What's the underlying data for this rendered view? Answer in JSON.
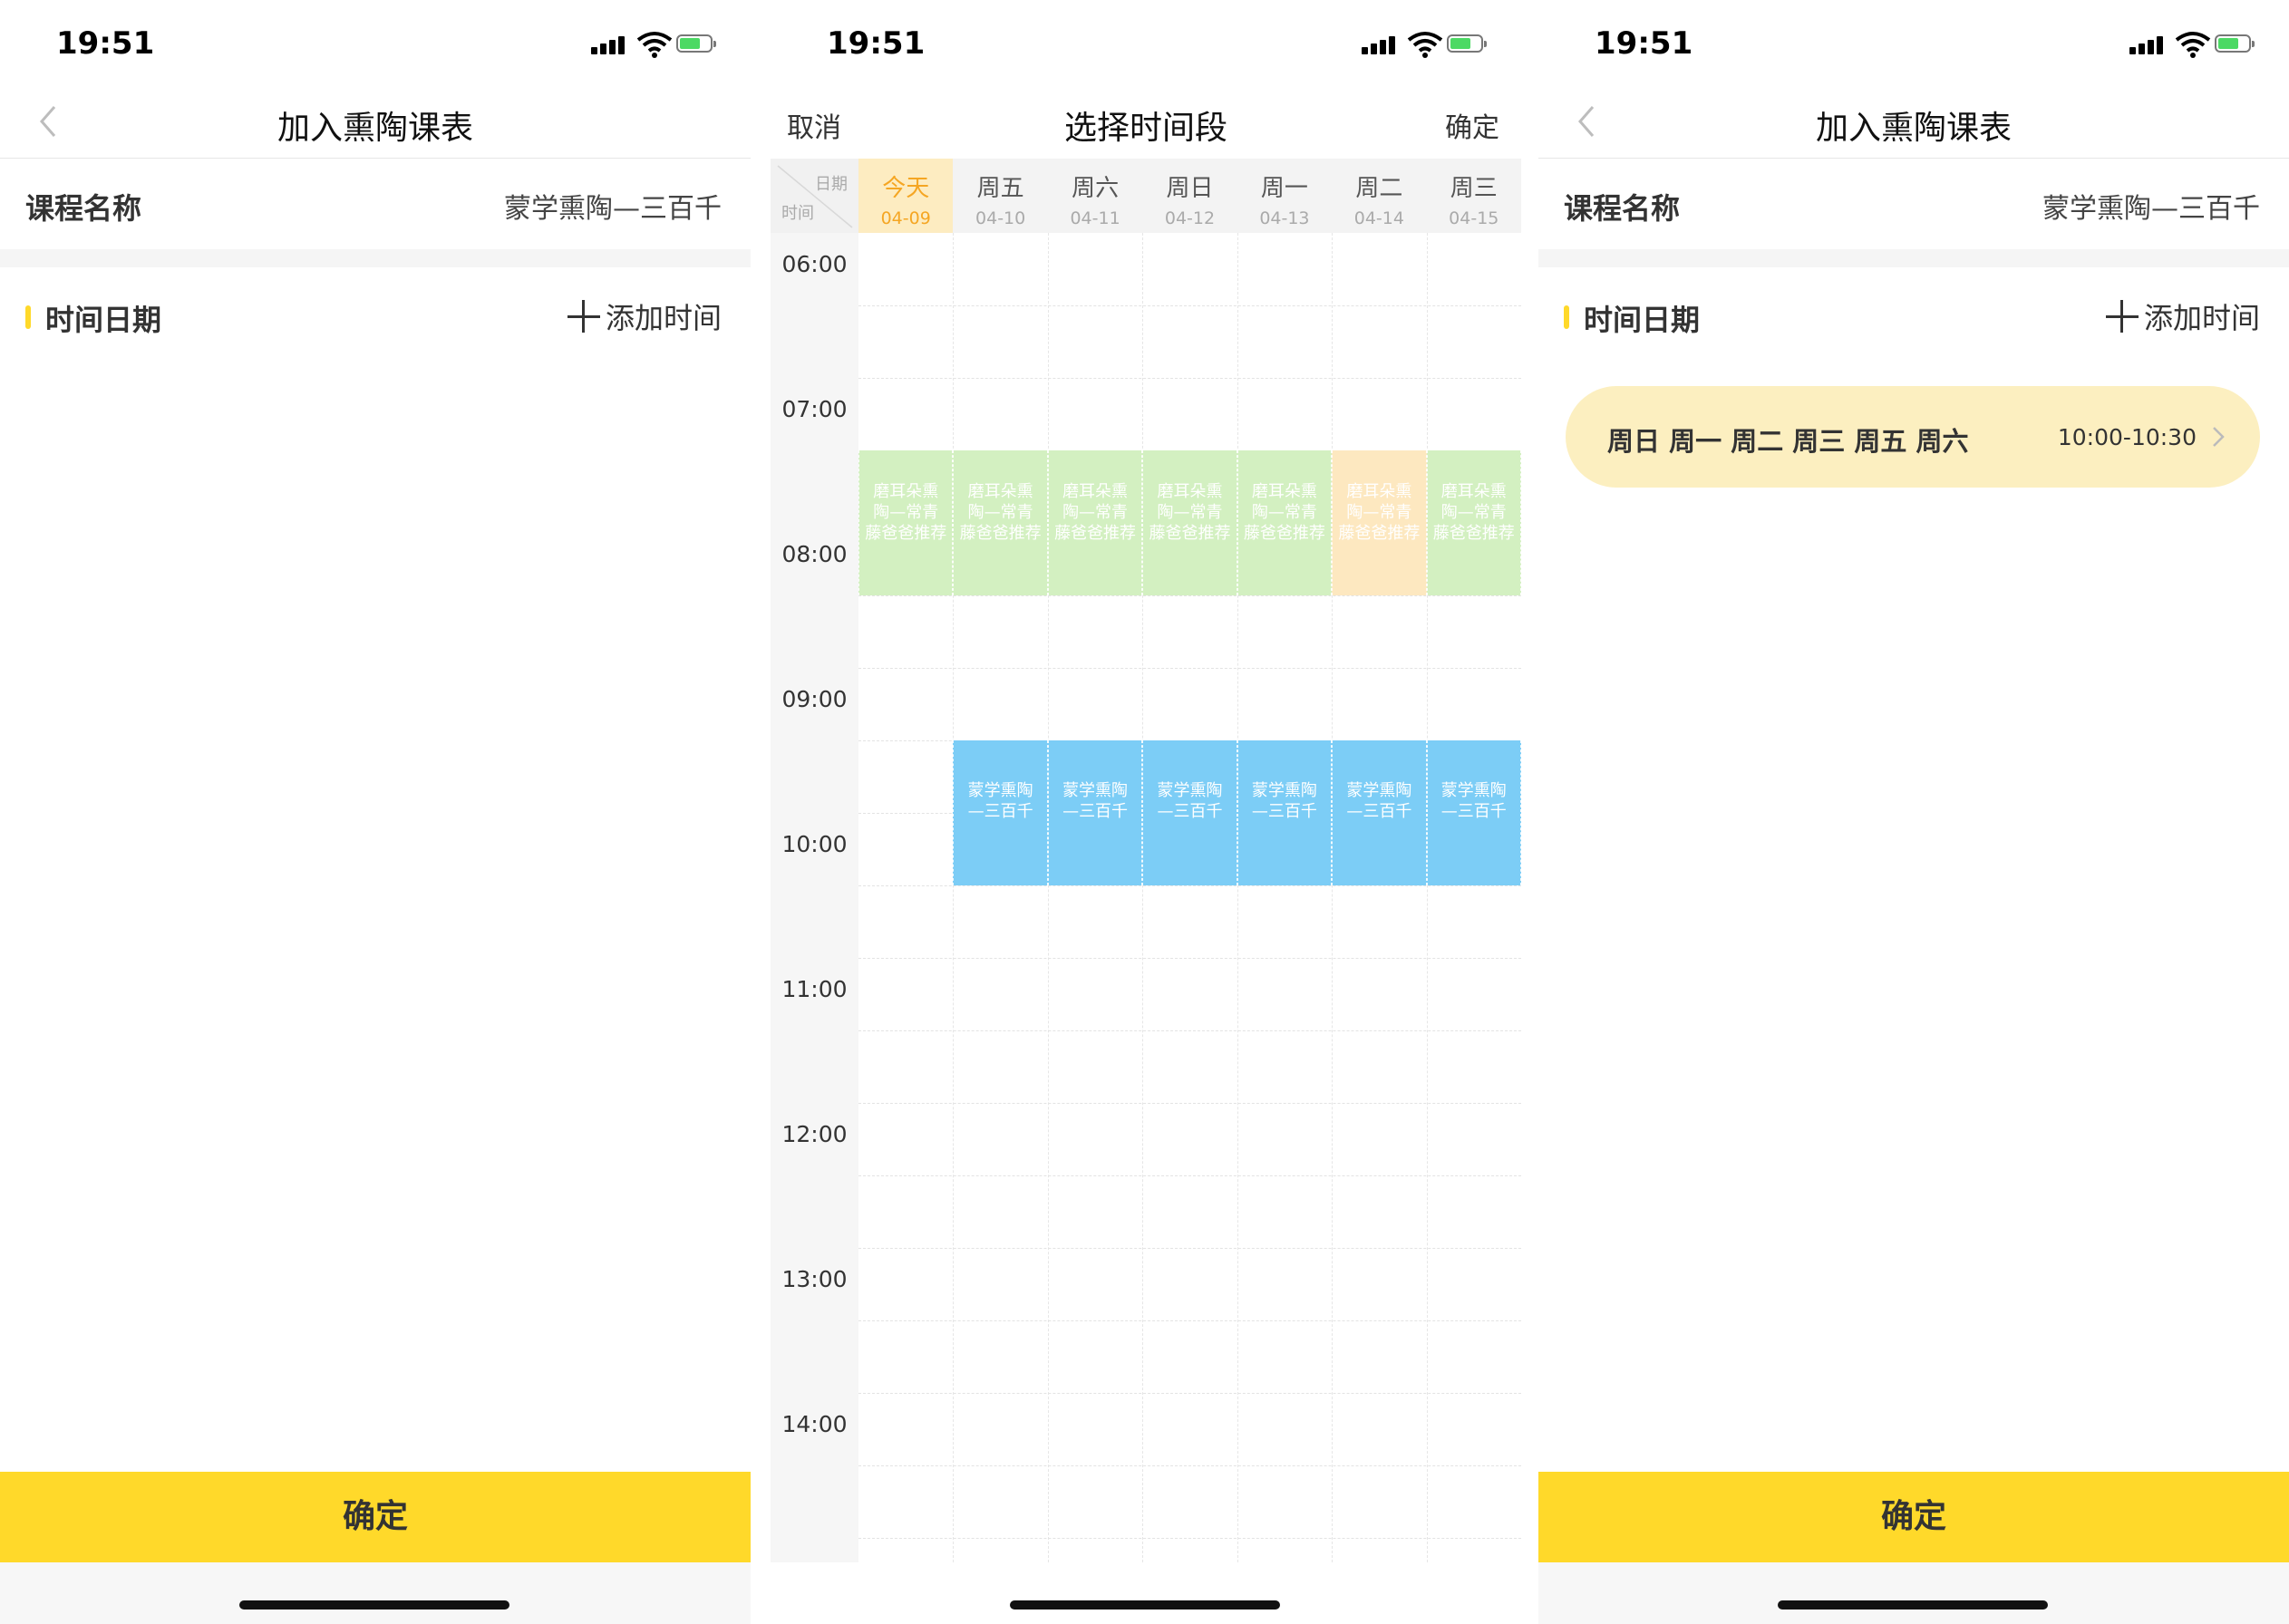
{
  "status_bar": {
    "time": "19:51"
  },
  "screen_add": {
    "title": "加入熏陶课表",
    "course_label": "课程名称",
    "course_value": "蒙学熏陶—三百千",
    "time_label": "时间日期",
    "add_time_label": "添加时间",
    "confirm_label": "确定"
  },
  "screen_select": {
    "title": "选择时间段",
    "cancel_label": "取消",
    "confirm_label": "确定",
    "corner_date": "日期",
    "corner_time": "时间",
    "days": [
      {
        "name": "今天",
        "date": "04-09",
        "today": true
      },
      {
        "name": "周五",
        "date": "04-10"
      },
      {
        "name": "周六",
        "date": "04-11"
      },
      {
        "name": "周日",
        "date": "04-12"
      },
      {
        "name": "周一",
        "date": "04-13"
      },
      {
        "name": "周二",
        "date": "04-14"
      },
      {
        "name": "周三",
        "date": "04-15"
      }
    ],
    "hours": [
      "06:00",
      "07:00",
      "08:00",
      "09:00",
      "10:00",
      "11:00",
      "12:00",
      "13:00",
      "14:00"
    ],
    "blocks": [
      {
        "day": 0,
        "start": 7.5,
        "end": 8.5,
        "color": "#d3f0c1",
        "lines": [
          "磨耳朵熏",
          "陶—常青",
          "藤爸爸推荐"
        ]
      },
      {
        "day": 1,
        "start": 7.5,
        "end": 8.5,
        "color": "#d3f0c1",
        "lines": [
          "磨耳朵熏",
          "陶—常青",
          "藤爸爸推荐"
        ]
      },
      {
        "day": 2,
        "start": 7.5,
        "end": 8.5,
        "color": "#d3f0c1",
        "lines": [
          "磨耳朵熏",
          "陶—常青",
          "藤爸爸推荐"
        ]
      },
      {
        "day": 3,
        "start": 7.5,
        "end": 8.5,
        "color": "#d3f0c1",
        "lines": [
          "磨耳朵熏",
          "陶—常青",
          "藤爸爸推荐"
        ]
      },
      {
        "day": 4,
        "start": 7.5,
        "end": 8.5,
        "color": "#d3f0c1",
        "lines": [
          "磨耳朵熏",
          "陶—常青",
          "藤爸爸推荐"
        ]
      },
      {
        "day": 5,
        "start": 7.5,
        "end": 8.5,
        "color": "#fde8c0",
        "lines": [
          "磨耳朵熏",
          "陶—常青",
          "藤爸爸推荐"
        ]
      },
      {
        "day": 6,
        "start": 7.5,
        "end": 8.5,
        "color": "#d3f0c1",
        "lines": [
          "磨耳朵熏",
          "陶—常青",
          "藤爸爸推荐"
        ]
      },
      {
        "day": 1,
        "start": 9.5,
        "end": 10.5,
        "color": "#7ccdf6",
        "lines": [
          "蒙学熏陶",
          "—三百千"
        ]
      },
      {
        "day": 2,
        "start": 9.5,
        "end": 10.5,
        "color": "#7ccdf6",
        "lines": [
          "蒙学熏陶",
          "—三百千"
        ]
      },
      {
        "day": 3,
        "start": 9.5,
        "end": 10.5,
        "color": "#7ccdf6",
        "lines": [
          "蒙学熏陶",
          "—三百千"
        ]
      },
      {
        "day": 4,
        "start": 9.5,
        "end": 10.5,
        "color": "#7ccdf6",
        "lines": [
          "蒙学熏陶",
          "—三百千"
        ]
      },
      {
        "day": 5,
        "start": 9.5,
        "end": 10.5,
        "color": "#7ccdf6",
        "lines": [
          "蒙学熏陶",
          "—三百千"
        ]
      },
      {
        "day": 6,
        "start": 9.5,
        "end": 10.5,
        "color": "#7ccdf6",
        "lines": [
          "蒙学熏陶",
          "—三百千"
        ]
      }
    ]
  },
  "screen_result": {
    "title": "加入熏陶课表",
    "course_label": "课程名称",
    "course_value": "蒙学熏陶—三百千",
    "time_label": "时间日期",
    "add_time_label": "添加时间",
    "schedule_days": "周日 周一 周二 周三 周五 周六",
    "schedule_range": "10:00-10:30",
    "confirm_label": "确定"
  },
  "colors": {
    "accent": "#ffd92a",
    "pill_bg": "#fcefc0",
    "today_bg": "#fdecc1",
    "today_text": "#f5a623"
  }
}
